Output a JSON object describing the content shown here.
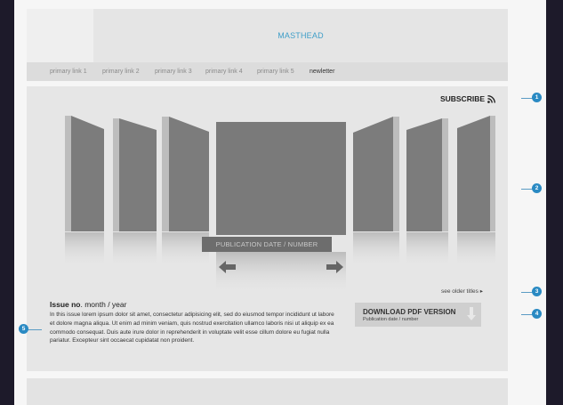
{
  "header": {
    "masthead": "MASTHEAD"
  },
  "nav": {
    "links": [
      "primary link 1",
      "primary link 2",
      "primary link 3",
      "primary link 4",
      "primary link 5",
      "newletter"
    ]
  },
  "main": {
    "subscribe_label": "SUBSCRIBE",
    "publication_label": "PUBLICATION DATE / NUMBER",
    "see_older": "see older titles",
    "issue": {
      "title_bold": "Issue no",
      "title_rest": ". month / year",
      "body": "In this issue lorem ipsum dolor sit amet, consectetur adipisicing elit, sed do eiusmod tempor incididunt ut labore et dolore magna aliqua. Ut enim ad minim veniam, quis nostrud exercitation ullamco laboris nisi ut aliquip ex ea commodo consequat. Duis aute irure dolor in reprehenderit in voluptate velit esse cillum dolore eu fugiat nulla pariatur. Excepteur sint occaecat cupidatat non proident."
    },
    "download": {
      "label": "DOWNLOAD PDF VERSION",
      "sub": "Publication date / number"
    }
  },
  "callouts": [
    "1",
    "2",
    "3",
    "4",
    "5"
  ],
  "colors": {
    "accent": "#2a8ac3",
    "masthead_text": "#3f9ec8",
    "cover": "#7a7a7a"
  },
  "icons": [
    "rss-icon",
    "arrow-left-icon",
    "arrow-right-icon",
    "chevron-right-icon",
    "download-arrow-icon"
  ]
}
